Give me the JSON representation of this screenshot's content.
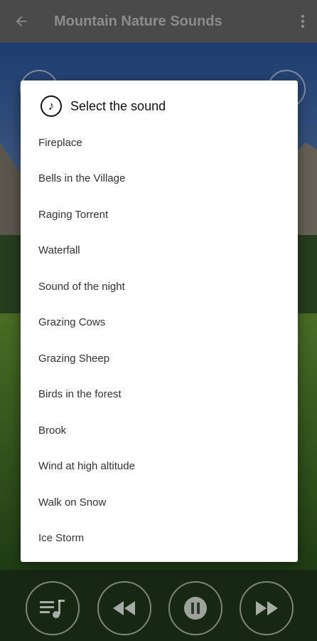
{
  "appbar": {
    "title": "Mountain Nature Sounds",
    "back_icon": "arrow-left-icon",
    "more_icon": "more-vert-icon"
  },
  "dialog": {
    "title": "Select the sound",
    "icon": "music-note-icon",
    "sounds": [
      "Fireplace",
      "Bells in the Village",
      "Raging Torrent",
      "Waterfall",
      "Sound of the night",
      "Grazing Cows",
      "Grazing Sheep",
      "Birds in the forest",
      "Brook",
      "Wind at high altitude",
      "Walk on Snow",
      "Ice Storm"
    ]
  },
  "controls": {
    "playlist_icon": "playlist-music-icon",
    "rewind_icon": "rewind-icon",
    "pause_icon": "pause-icon",
    "forward_icon": "fast-forward-icon"
  },
  "colors": {
    "appbar": "#4a4a4a",
    "dialog_bg": "#ffffff",
    "text": "#333333"
  }
}
